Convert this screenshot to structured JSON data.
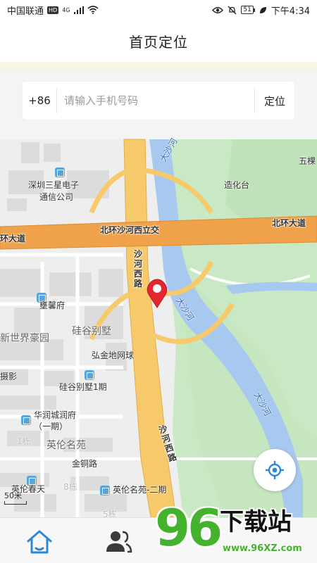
{
  "status_bar": {
    "carrier": "中国联通",
    "hd": "HD",
    "network": "4G",
    "battery": "51",
    "time": "下午4:34"
  },
  "header": {
    "title": "首页定位"
  },
  "phone_bar": {
    "country_code": "+86",
    "placeholder": "请输入手机号码",
    "locate_label": "定位"
  },
  "map": {
    "labels": {
      "samsung_l1": "深圳三星电子",
      "samsung_l2": "通信公司",
      "zaohuatai": "造化台",
      "wuke": "五棵",
      "beihuan_west": "环大道",
      "beihuan_interchange": "北环沙河西立交",
      "beihuan_east": "北环大道",
      "tuanfu": "壅馨府",
      "xinshijie": "新世界豪园",
      "guigu_villa": "硅谷别墅",
      "hongjin": "弘金地网球",
      "sheying": "摄影",
      "guigu_phase1": "硅谷别墅1期",
      "huarun_l1": "华润城润府",
      "huarun_l2": "（一期）",
      "building1": "1栋",
      "yinglun": "英伦名苑",
      "jintong": "金铜路",
      "yinglun_spring": "英伦春天",
      "building8": "8栋",
      "yinglun_phase2": "英伦名苑-二期",
      "building5": "5栋",
      "river_top": "大沙河",
      "river_mid": "大沙河",
      "river_lower": "大沙河",
      "shahe_west_upper": "沙河西路",
      "shahe_west_lower": "沙河西路"
    },
    "scale": "50米"
  },
  "icons": {
    "pin": "map-pin-icon",
    "locate_me": "crosshair-icon",
    "home": "home-icon",
    "contacts": "contacts-icon"
  },
  "watermark": {
    "digits": "96",
    "text": "下载站",
    "url": "www.96XZ.com"
  },
  "colors": {
    "road_main": "#f6c96a",
    "road_highway": "#f0a24a",
    "river": "#a7c8ef",
    "green": "#c9e8c4",
    "pin": "#e3262f",
    "nav_icon": "#2d87d6",
    "watermark_green": "#45b22e"
  }
}
